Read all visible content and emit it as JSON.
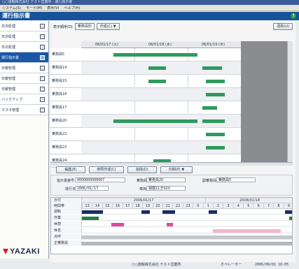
{
  "window": {
    "title": "○○運輸株式会社 テスト営業所 - 運行指示書"
  },
  "menu": {
    "items": [
      "システム(S)",
      "モード(M)",
      "表示(V)",
      "ヘルプ(H)"
    ]
  },
  "app": {
    "title": "運行指示書",
    "help_icon": "?"
  },
  "sidebar": {
    "items": [
      {
        "label": "日次処理",
        "icon": "document-icon",
        "active": false
      },
      {
        "label": "日次処理",
        "icon": "document-icon",
        "active": false
      },
      {
        "label": "日次処理",
        "icon": "edit-icon",
        "active": false
      },
      {
        "label": "運行指示書",
        "icon": "document-icon",
        "active": true
      },
      {
        "label": "日報管理",
        "icon": "document-icon",
        "active": false
      },
      {
        "label": "日報管理",
        "icon": "settings-icon",
        "active": false
      },
      {
        "label": "日報管理",
        "icon": "table-icon",
        "active": false
      },
      {
        "label": "バックアップ",
        "icon": "backup-icon",
        "active": false
      },
      {
        "label": "マスタ管理",
        "icon": "database-icon",
        "active": false
      }
    ]
  },
  "logo": {
    "text": "YAZAKI"
  },
  "toolbar": {
    "display_label": "表示順序(D)",
    "sort_value": "乗務員別",
    "create_label": "作成(C) ▼",
    "update_label": "更新(U)"
  },
  "gantt": {
    "dates": [
      "06/01/17 (火)",
      "06/01/18 (水)",
      "06/01/19 (木)"
    ],
    "rows": [
      {
        "label": "乗務員5",
        "bars": [
          [
            0.2,
            0.73
          ]
        ]
      },
      {
        "label": "乗務員14",
        "bars": [
          [
            0.42,
            0.53
          ],
          [
            0.76,
            0.88
          ]
        ]
      },
      {
        "label": "乗務員15",
        "bars": [
          [
            0.42,
            0.53
          ],
          [
            0.78,
            0.9
          ]
        ]
      },
      {
        "label": "乗務員16",
        "bars": [
          [
            0.78,
            0.9
          ]
        ]
      },
      {
        "label": "乗務員17",
        "bars": [
          [
            0.76,
            0.85
          ]
        ]
      },
      {
        "label": "乗務員20",
        "bars": [
          [
            0.2,
            0.73
          ],
          [
            0.76,
            0.9
          ]
        ]
      },
      {
        "label": "乗務員22",
        "bars": [
          [
            0.78,
            0.9
          ]
        ]
      },
      {
        "label": "乗務員23",
        "bars": [
          [
            0.78,
            0.9
          ]
        ]
      },
      {
        "label": "乗務員24",
        "bars": [
          [
            0.45,
            0.56
          ]
        ]
      }
    ]
  },
  "actions": {
    "edit": "編集(E)",
    "ref_create": "参照作成(C)",
    "delete": "削除(D)",
    "print": "印刷(P) ▼"
  },
  "detail": {
    "no_label": "指示書番号",
    "no_value": "0000000000007",
    "crew_label": "乗務員",
    "crew_value": "乗務員20",
    "subcrew_label": "副乗務員",
    "subcrew_value": "乗務員5",
    "date_label": "運行日",
    "date_value": "2006/01/17",
    "vehicle_label": "車両",
    "vehicle_value": "相模11き020"
  },
  "timeline": {
    "date_label": "日付",
    "date1": "2006/01/17",
    "date2": "2006/01/18",
    "hours_label": "時間帯",
    "hours": [
      "13",
      "14",
      "15",
      "16",
      "17",
      "18",
      "19",
      "20",
      "21",
      "22",
      "23",
      "0",
      "1",
      "2",
      "3",
      "4",
      "5",
      "6",
      "7",
      "8",
      "9"
    ],
    "rows": [
      {
        "label": "運転",
        "color": "#1b2d64"
      },
      {
        "label": "作業",
        "color": "#1e7f46"
      },
      {
        "label": "休憩",
        "color": "#e24a9a"
      },
      {
        "label": "休息",
        "color": "#f4b6cf"
      },
      {
        "label": "点呼",
        "color": "#c4c7cc"
      },
      {
        "label": "正乗務員",
        "color": "#b4b8be"
      }
    ]
  },
  "status": {
    "company": "○○運輸株式会社 テスト営業所",
    "user": "オペレーター",
    "datetime": "2006/09/01 16:05"
  }
}
